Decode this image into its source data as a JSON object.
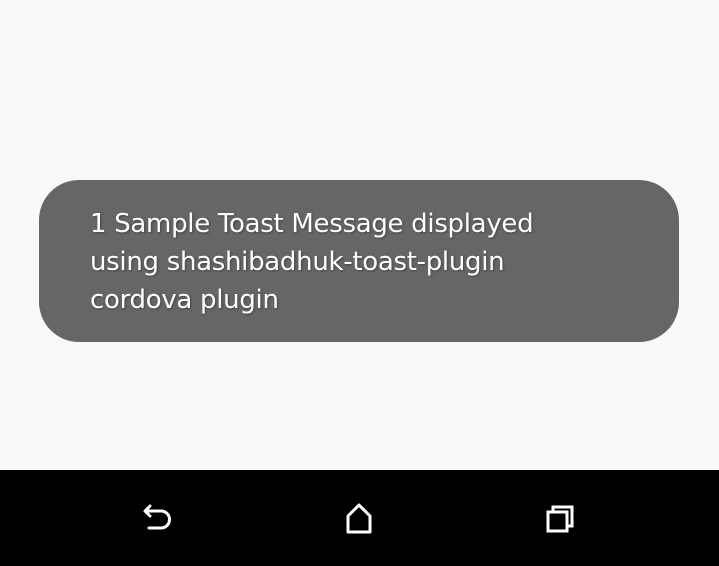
{
  "toast": {
    "message": "1 Sample Toast Message displayed using shashibadhuk-toast-plugin cordova plugin"
  },
  "colors": {
    "screen_background": "#f9f9f9",
    "toast_background": "#666666",
    "toast_text": "#ffffff",
    "navbar_background": "#000000",
    "navbar_icon": "#ffffff"
  },
  "navbar": {
    "buttons": [
      {
        "icon": "back-icon"
      },
      {
        "icon": "home-icon"
      },
      {
        "icon": "recents-icon"
      }
    ]
  }
}
